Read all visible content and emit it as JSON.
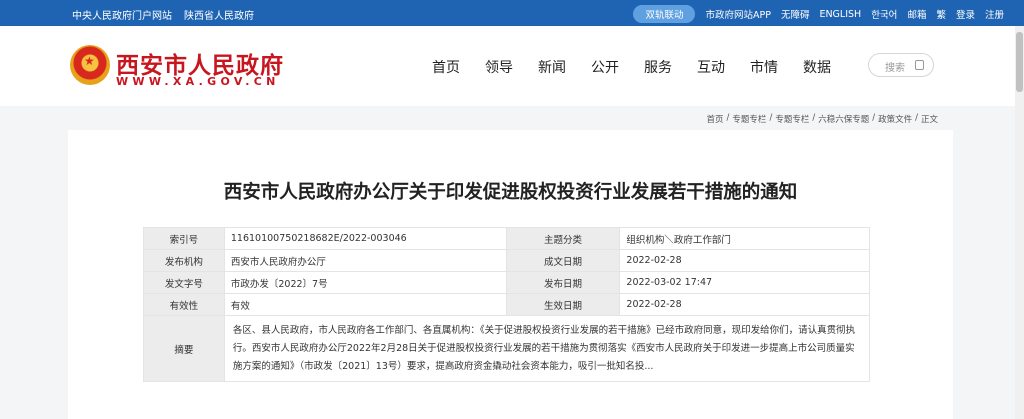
{
  "topbar": {
    "links_left": [
      "中央人民政府门户网站",
      "陕西省人民政府"
    ],
    "toggle_label": "双轨联动",
    "links_right": [
      "市政府网站APP",
      "无障碍",
      "ENGLISH",
      "한국어",
      "邮箱",
      "繁",
      "登录",
      "注册"
    ]
  },
  "header": {
    "logo_title": "西安市人民政府",
    "logo_url": "WWW.XA.GOV.CN",
    "nav": [
      "首页",
      "领导",
      "新闻",
      "公开",
      "服务",
      "互动",
      "市情",
      "数据"
    ],
    "search_placeholder": "搜索"
  },
  "breadcrumb": [
    "首页",
    "专题专栏",
    "专题专栏",
    "六稳六保专题",
    "政策文件",
    "正文"
  ],
  "article": {
    "title": "西安市人民政府办公厅关于印发促进股权投资行业发展若干措施的通知",
    "meta": {
      "index_label": "索引号",
      "index_value": "11610100750218682E/2022-003046",
      "topic_label": "主题分类",
      "topic_value": "组织机构＼政府工作部门",
      "publisher_label": "发布机构",
      "publisher_value": "西安市人民政府办公厅",
      "date_label": "成文日期",
      "date_value": "2022-02-28",
      "docno_label": "发文字号",
      "docno_value": "市政办发〔2022〕7号",
      "pubdate_label": "发布日期",
      "pubdate_value": "2022-03-02 17:47",
      "validity_label": "有效性",
      "validity_value": "有效",
      "effective_label": "生效日期",
      "effective_value": "2022-02-28",
      "abstract_label": "摘要",
      "abstract_value": "各区、县人民政府，市人民政府各工作部门、各直属机构：《关于促进股权投资行业发展的若干措施》已经市政府同意，现印发给你们，请认真贯彻执行。西安市人民政府办公厅2022年2月28日关于促进股权投资行业发展的若干措施为贯彻落实《西安市人民政府关于印发进一步提高上市公司质量实施方案的通知》（市政发〔2021〕13号）要求，提高政府资金撬动社会资本能力，吸引一批知名投..."
    }
  },
  "colors": {
    "topbar": "#1f64b3",
    "brand_red": "#c8161e",
    "table_header": "#ececec"
  }
}
